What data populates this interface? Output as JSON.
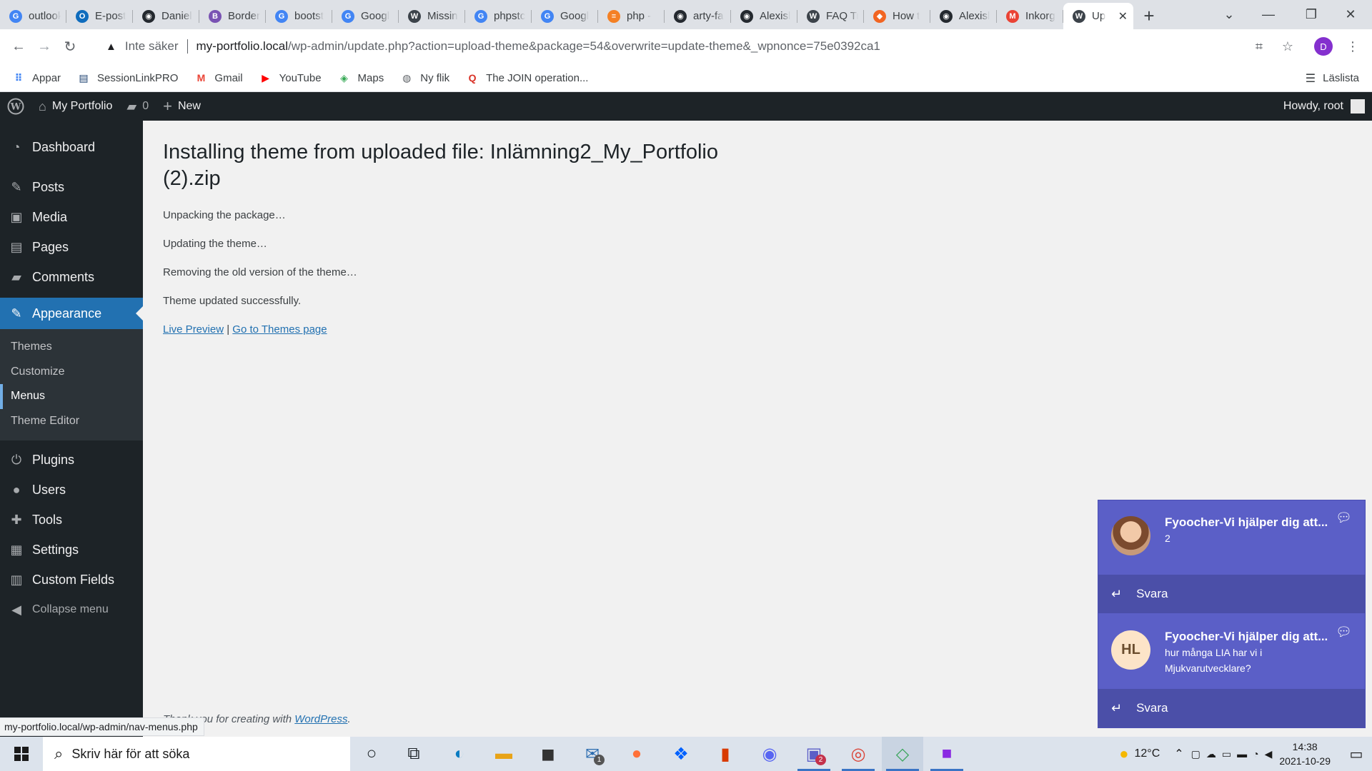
{
  "browser": {
    "tabs": [
      {
        "label": "outlook",
        "icon": "google-icon",
        "color": "#4285f4"
      },
      {
        "label": "E-post",
        "icon": "outlook-icon",
        "color": "#0f6cbd"
      },
      {
        "label": "Daniel",
        "icon": "github-icon",
        "color": "#24292f"
      },
      {
        "label": "Border",
        "icon": "bootstrap-icon",
        "color": "#7952b3"
      },
      {
        "label": "bootst",
        "icon": "google-icon",
        "color": "#4285f4"
      },
      {
        "label": "Googl",
        "icon": "google-icon",
        "color": "#4285f4"
      },
      {
        "label": "Missin",
        "icon": "wordpress-icon",
        "color": "#3c434a"
      },
      {
        "label": "phpstc",
        "icon": "google-icon",
        "color": "#4285f4"
      },
      {
        "label": "Googl",
        "icon": "google-icon",
        "color": "#4285f4"
      },
      {
        "label": "php -",
        "icon": "stackoverflow-icon",
        "color": "#f48024"
      },
      {
        "label": "arty-fa",
        "icon": "github-icon",
        "color": "#24292f"
      },
      {
        "label": "Alexisl",
        "icon": "github-icon",
        "color": "#24292f"
      },
      {
        "label": "FAQ Tr",
        "icon": "wordpress-icon",
        "color": "#3c434a"
      },
      {
        "label": "How t",
        "icon": "codegrepper-icon",
        "color": "#f26522"
      },
      {
        "label": "Alexisl",
        "icon": "github-icon",
        "color": "#24292f"
      },
      {
        "label": "Inkorg",
        "icon": "gmail-icon",
        "color": "#ea4335"
      }
    ],
    "active_tab": {
      "label": "Up",
      "icon": "wordpress-icon",
      "color": "#3c434a",
      "close": "✕"
    },
    "new_tab": "+",
    "address": {
      "security_label": "Inte säker",
      "host": "my-portfolio.local",
      "path": "/wp-admin/update.php?action=upload-theme&package=54&overwrite=update-theme&_wpnonce=75e0392ca1"
    },
    "profile_initial": "D",
    "bookmarks": [
      {
        "label": "Appar",
        "icon": "apps-grid-icon"
      },
      {
        "label": "SessionLinkPRO",
        "icon": "sessionlink-icon"
      },
      {
        "label": "Gmail",
        "icon": "gmail-icon"
      },
      {
        "label": "YouTube",
        "icon": "youtube-icon"
      },
      {
        "label": "Maps",
        "icon": "maps-icon"
      },
      {
        "label": "Ny flik",
        "icon": "globe-icon"
      },
      {
        "label": "The JOIN operation...",
        "icon": "sqlzoo-icon"
      }
    ],
    "reading_list": "Läslista"
  },
  "adminbar": {
    "site_name": "My Portfolio",
    "comments_count": "0",
    "new_label": "New",
    "howdy": "Howdy, root"
  },
  "sidebar": {
    "top": [
      {
        "label": "Dashboard",
        "icon": "dashboard-icon"
      }
    ],
    "items_a": [
      {
        "label": "Posts",
        "icon": "pushpin-icon"
      },
      {
        "label": "Media",
        "icon": "media-icon"
      },
      {
        "label": "Pages",
        "icon": "pages-icon"
      },
      {
        "label": "Comments",
        "icon": "comments-icon"
      }
    ],
    "current": {
      "label": "Appearance",
      "icon": "paintbrush-icon"
    },
    "submenu": [
      {
        "label": "Themes",
        "current": false
      },
      {
        "label": "Customize",
        "current": false
      },
      {
        "label": "Menus",
        "current": true
      },
      {
        "label": "Theme Editor",
        "current": false
      }
    ],
    "items_b": [
      {
        "label": "Plugins",
        "icon": "plugin-icon"
      },
      {
        "label": "Users",
        "icon": "users-icon"
      },
      {
        "label": "Tools",
        "icon": "wrench-icon"
      },
      {
        "label": "Settings",
        "icon": "settings-icon"
      },
      {
        "label": "Custom Fields",
        "icon": "table-icon"
      }
    ],
    "collapse": "Collapse menu"
  },
  "main": {
    "title": "Installing theme from uploaded file: Inlämning2_My_Portfolio (2).zip",
    "log": [
      "Unpacking the package…",
      "Updating the theme…",
      "Removing the old version of the theme…",
      "Theme updated successfully."
    ],
    "live_preview": "Live Preview",
    "separator": "|",
    "themes_link": "Go to Themes page",
    "footer_prefix": "Thank you for creating with",
    "footer_link": "WordPress",
    "footer_suffix": ".",
    "status_url": "my-portfolio.local/wp-admin/nav-menus.php"
  },
  "notifications": [
    {
      "title": "Fyoocher-Vi hjälper dig att...",
      "body": "2",
      "avatar": "photo",
      "initials": "",
      "reply": "Svara"
    },
    {
      "title": "Fyoocher-Vi hjälper dig att...",
      "body": "hur många LIA har vi i Mjukvarutvecklare?",
      "avatar": "initials",
      "initials": "HL",
      "reply": "Svara"
    }
  ],
  "taskbar": {
    "search_placeholder": "Skriv här för att söka",
    "temperature": "12°C",
    "time": "14:38",
    "date": "2021-10-29",
    "mail_badge": "1",
    "teams_badge": "2"
  },
  "colors": {
    "wp_dark": "#1d2327",
    "wp_blue": "#2271b1",
    "teams_purple": "#5b5fc7"
  }
}
